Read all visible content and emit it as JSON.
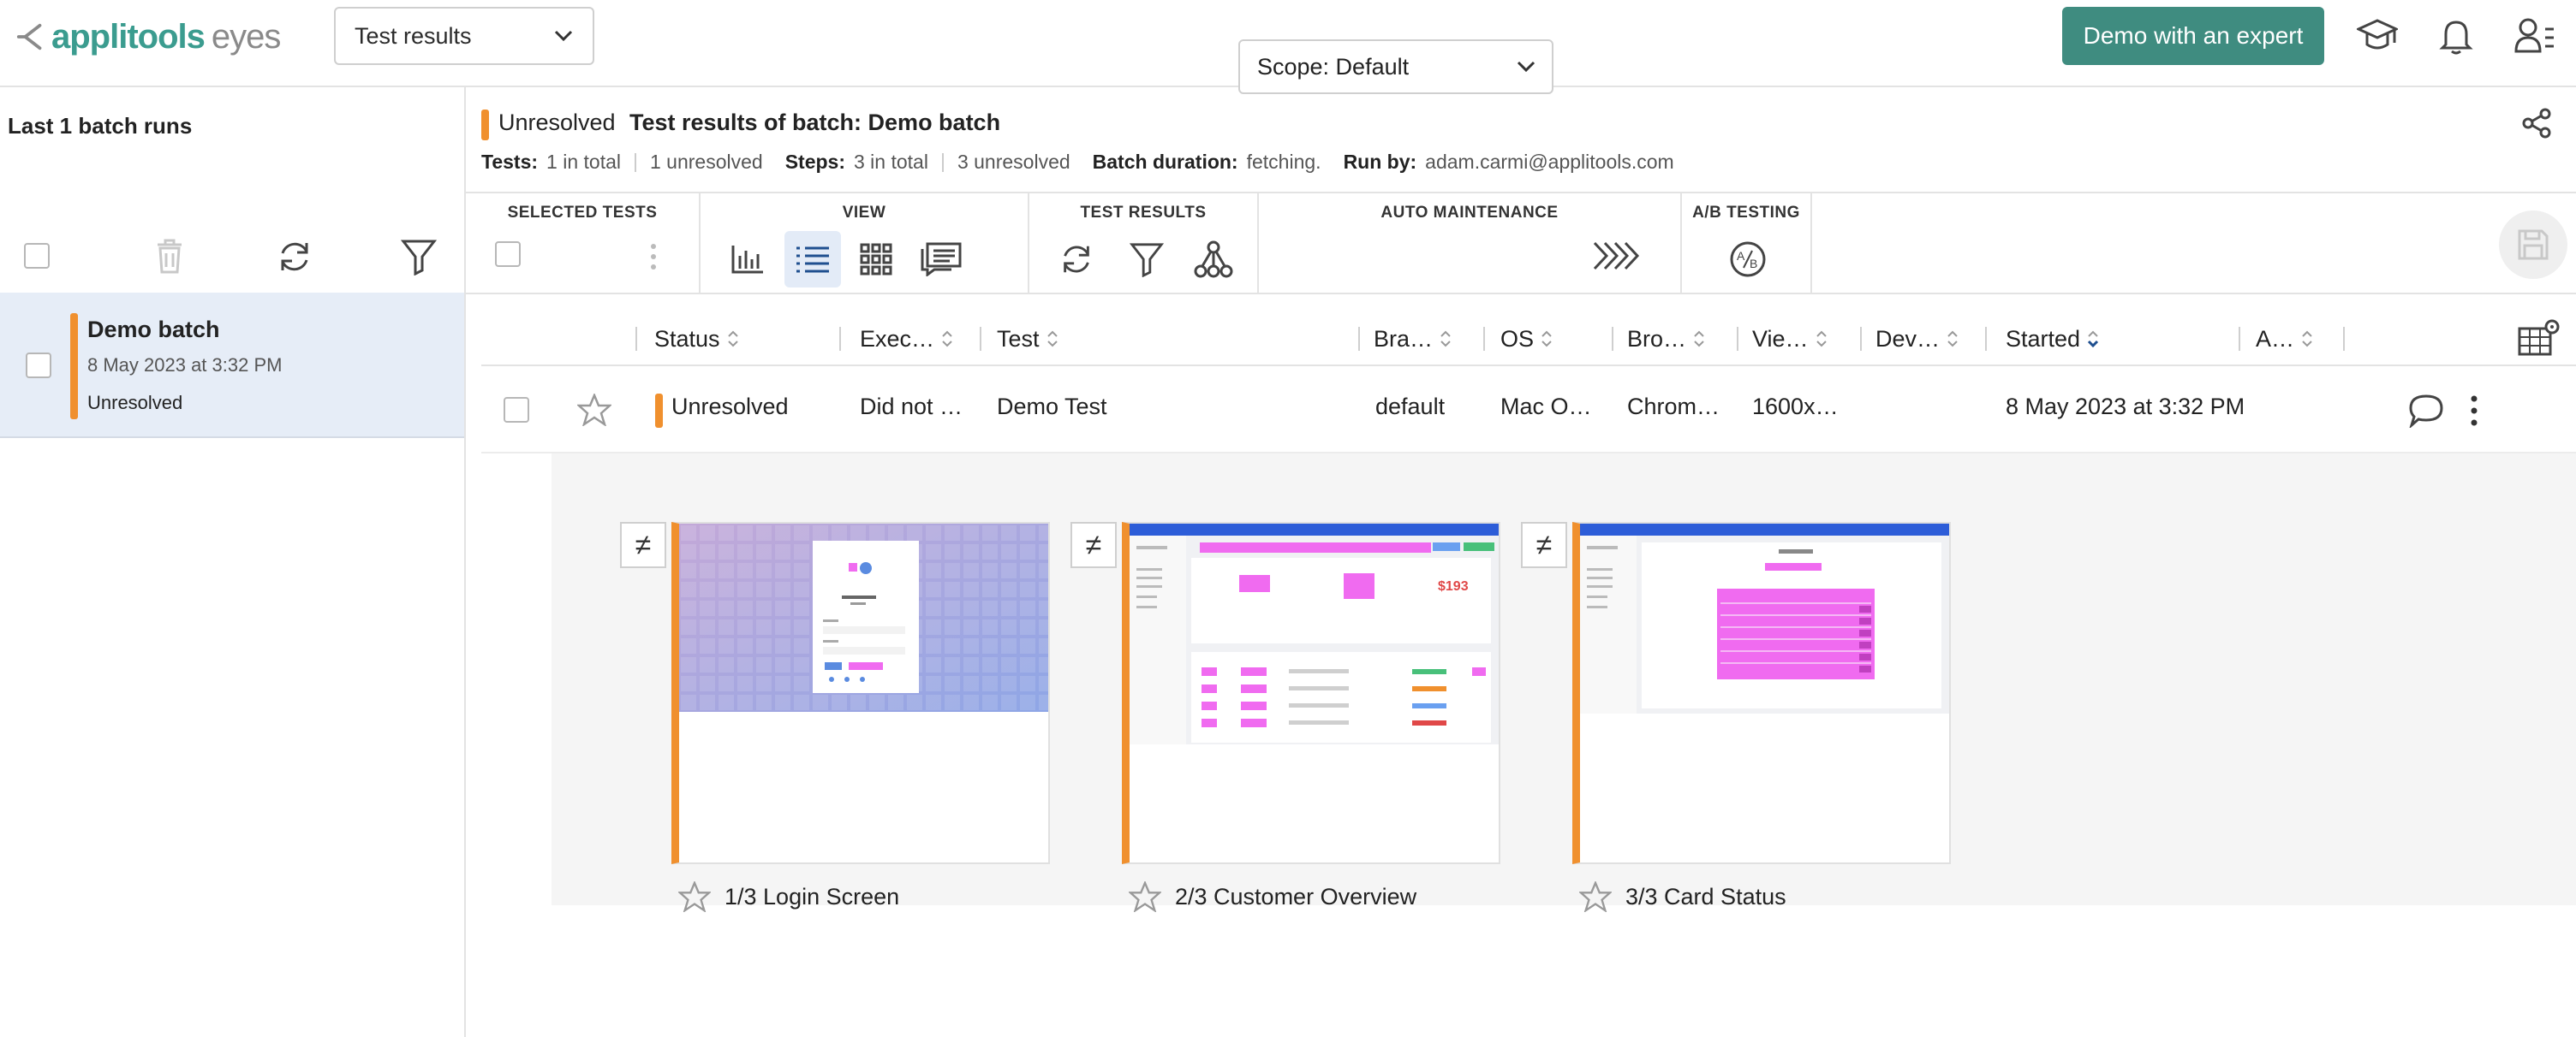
{
  "app": {
    "logo_primary": "applitools",
    "logo_secondary": "eyes"
  },
  "top": {
    "results_select": "Test results",
    "demo_button": "Demo with an expert"
  },
  "left_panel": {
    "title": "Last 1 batch runs",
    "batch": {
      "name": "Demo batch",
      "date": "8 May 2023 at 3:32 PM",
      "status": "Unresolved"
    }
  },
  "header": {
    "status": "Unresolved",
    "title": "Test results of batch:  Demo batch",
    "meta": {
      "tests_label": "Tests:",
      "tests_total": "1 in total",
      "tests_unresolved": "1 unresolved",
      "steps_label": "Steps:",
      "steps_total": "3 in total",
      "steps_unresolved": "3 unresolved",
      "duration_label": "Batch duration:",
      "duration_value": "fetching.",
      "runby_label": "Run by:",
      "runby_value": "adam.carmi@applitools.com"
    }
  },
  "toolbar": {
    "selected_tests": "SELECTED TESTS",
    "view": "VIEW",
    "test_results": "TEST RESULTS",
    "auto_maintenance": "AUTO MAINTENANCE",
    "ab_testing": "A/B TESTING",
    "scope": "Scope: Default"
  },
  "table": {
    "columns": [
      "Status",
      "Exec…",
      "Test",
      "Bra…",
      "OS",
      "Bro…",
      "Vie…",
      "Dev…",
      "Started",
      "A…"
    ],
    "row": {
      "status": "Unresolved",
      "execution": "Did not …",
      "test": "Demo Test",
      "branch": "default",
      "os": "Mac O…",
      "browser": "Chrom…",
      "viewport": "1600x…",
      "device": "",
      "started": "8 May 2023 at 3:32 PM"
    }
  },
  "steps": [
    {
      "label": "1/3 Login Screen"
    },
    {
      "label": "2/3 Customer Overview"
    },
    {
      "label": "3/3 Card Status"
    }
  ],
  "colors": {
    "accent": "#3f8c80",
    "unresolved": "#f0902e",
    "selected_bg": "#e6edf7",
    "diff_highlight": "#f06bf0"
  }
}
